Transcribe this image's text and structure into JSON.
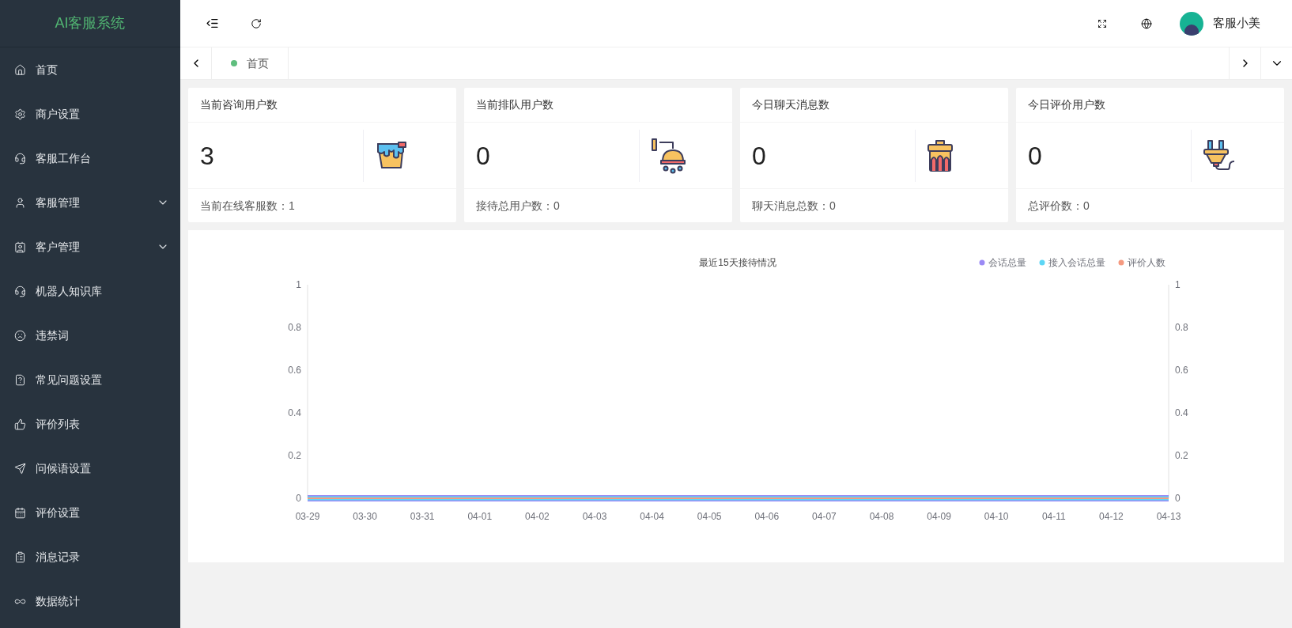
{
  "sidebar": {
    "logo": "AI客服系统",
    "items": [
      {
        "label": "首页",
        "expandable": false
      },
      {
        "label": "商户设置",
        "expandable": false
      },
      {
        "label": "客服工作台",
        "expandable": false
      },
      {
        "label": "客服管理",
        "expandable": true
      },
      {
        "label": "客户管理",
        "expandable": true
      },
      {
        "label": "机器人知识库",
        "expandable": false
      },
      {
        "label": "违禁词",
        "expandable": false
      },
      {
        "label": "常见问题设置",
        "expandable": false
      },
      {
        "label": "评价列表",
        "expandable": false
      },
      {
        "label": "问候语设置",
        "expandable": false
      },
      {
        "label": "评价设置",
        "expandable": false
      },
      {
        "label": "消息记录",
        "expandable": false
      },
      {
        "label": "数据统计",
        "expandable": false
      }
    ]
  },
  "header": {
    "user_name": "客服小美"
  },
  "tabs": [
    {
      "label": "首页",
      "selected": true
    }
  ],
  "stat_cards": [
    {
      "title": "当前咨询用户数",
      "value": "3",
      "footer": "当前在线客服数：1"
    },
    {
      "title": "当前排队用户数",
      "value": "0",
      "footer": "接待总用户数：0"
    },
    {
      "title": "今日聊天消息数",
      "value": "0",
      "footer": "聊天消息总数：0"
    },
    {
      "title": "今日评价用户数",
      "value": "0",
      "footer": "总评价数：0"
    }
  ],
  "chart": {
    "chart_data": {
      "type": "line",
      "title": "最近15天接待情况",
      "legend": "top-right",
      "categories": [
        "03-29",
        "03-30",
        "03-31",
        "04-01",
        "04-02",
        "04-03",
        "04-04",
        "04-05",
        "04-06",
        "04-07",
        "04-08",
        "04-09",
        "04-10",
        "04-11",
        "04-12",
        "04-13"
      ],
      "series": [
        {
          "name": "会话总量",
          "color": "#9b8af5",
          "values": [
            0,
            0,
            0,
            0,
            0,
            0,
            0,
            0,
            0,
            0,
            0,
            0,
            0,
            0,
            0,
            0
          ]
        },
        {
          "name": "接入会话总量",
          "color": "#5dd6f5",
          "values": [
            0,
            0,
            0,
            0,
            0,
            0,
            0,
            0,
            0,
            0,
            0,
            0,
            0,
            0,
            0,
            0
          ]
        },
        {
          "name": "评价人数",
          "color": "#f59a80",
          "values": [
            0,
            0,
            0,
            0,
            0,
            0,
            0,
            0,
            0,
            0,
            0,
            0,
            0,
            0,
            0,
            0
          ]
        }
      ],
      "ylim": [
        0,
        1
      ],
      "yticks": [
        0,
        0.2,
        0.4,
        0.6,
        0.8,
        1
      ],
      "y2ticks": [
        0,
        0.2,
        0.4,
        0.6,
        0.8,
        1
      ],
      "y2lim": [
        0,
        1
      ]
    }
  }
}
